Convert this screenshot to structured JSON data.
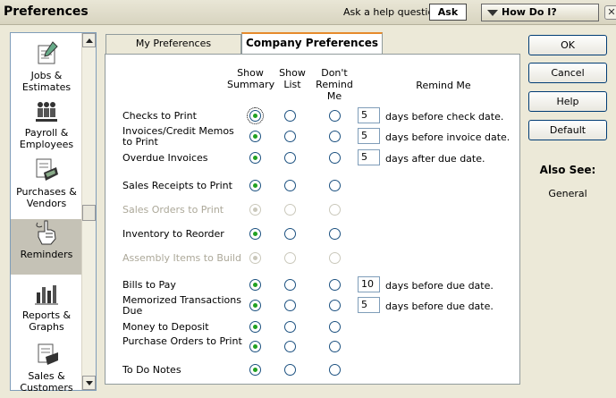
{
  "window": {
    "title": "Preferences",
    "help_question": "Ask a help question",
    "ask_label": "Ask",
    "how_do_i_label": "How Do I?",
    "close_glyph": "✕"
  },
  "sidebar": {
    "items": [
      {
        "label": "Jobs & Estimates",
        "icon": "notepad-icon",
        "selected": false
      },
      {
        "label": "Payroll & Employees",
        "icon": "people-icon",
        "selected": false
      },
      {
        "label": "Purchases & Vendors",
        "icon": "purchases-icon",
        "selected": false
      },
      {
        "label": "Reminders",
        "icon": "hand-finger-icon",
        "selected": true
      },
      {
        "label": "Reports & Graphs",
        "icon": "bar-chart-icon",
        "selected": false
      },
      {
        "label": "Sales & Customers",
        "icon": "sales-icon",
        "selected": false
      }
    ]
  },
  "tabs": [
    {
      "label": "My Preferences",
      "active": false
    },
    {
      "label": "Company Preferences",
      "active": true
    }
  ],
  "columns": {
    "show_summary": "Show Summary",
    "show_list": "Show List",
    "dont_remind": "Don't Remind Me",
    "remind_me": "Remind Me"
  },
  "rows": [
    {
      "label": "Checks to Print",
      "selected": "summary",
      "enabled": true,
      "days": "5",
      "remind": "days before check date."
    },
    {
      "label": "Invoices/Credit Memos to Print",
      "selected": "summary",
      "enabled": true,
      "days": "5",
      "remind": "days before invoice date."
    },
    {
      "label": "Overdue Invoices",
      "selected": "summary",
      "enabled": true,
      "days": "5",
      "remind": "days after due date."
    },
    {
      "label": "Sales Receipts to Print",
      "selected": "summary",
      "enabled": true,
      "days": "",
      "remind": ""
    },
    {
      "label": "Sales Orders to Print",
      "selected": "summary",
      "enabled": false,
      "days": "",
      "remind": ""
    },
    {
      "label": "Inventory to Reorder",
      "selected": "summary",
      "enabled": true,
      "days": "",
      "remind": ""
    },
    {
      "label": "Assembly Items to Build",
      "selected": "summary",
      "enabled": false,
      "days": "",
      "remind": ""
    },
    {
      "label": "Bills to Pay",
      "selected": "summary",
      "enabled": true,
      "days": "10",
      "remind": "days before due date."
    },
    {
      "label": "Memorized Transactions Due",
      "selected": "summary",
      "enabled": true,
      "days": "5",
      "remind": "days before due date."
    },
    {
      "label": "Money to Deposit",
      "selected": "summary",
      "enabled": true,
      "days": "",
      "remind": ""
    },
    {
      "label": "Purchase Orders to Print",
      "selected": "summary",
      "enabled": true,
      "days": "",
      "remind": ""
    },
    {
      "label": "To Do Notes",
      "selected": "summary",
      "enabled": true,
      "days": "",
      "remind": ""
    }
  ],
  "buttons": {
    "ok": "OK",
    "cancel": "Cancel",
    "help": "Help",
    "default": "Default"
  },
  "also_see": {
    "heading": "Also See:",
    "link": "General"
  },
  "colors": {
    "selected_radio": "#21a121",
    "active_tab_accent": "#e68b2c"
  }
}
